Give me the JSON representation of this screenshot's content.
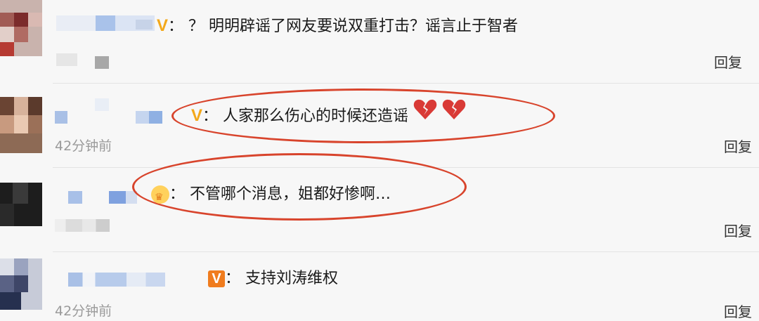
{
  "comments": [
    {
      "badge": "V",
      "text": "：  ？ 明明辟谣了网友要说双重打击？谣言止于智者",
      "time": "",
      "reply": "回复"
    },
    {
      "badge": "V",
      "text": "：  人家那么伤心的时候还造谣",
      "time": "42分钟前",
      "reply": "回复",
      "emojis": [
        "broken-heart",
        "broken-heart"
      ]
    },
    {
      "badge": "crown",
      "text": "：  不管哪个消息，姐都好惨啊…",
      "time": "",
      "reply": "回复"
    },
    {
      "badge": "V",
      "text": "：  支持刘涛维权",
      "time": "42分钟前",
      "reply": "回复"
    }
  ],
  "colors": {
    "accent_v": "#f3a81a",
    "annotation_circle": "#d8442c",
    "heart": "#d93a36"
  }
}
